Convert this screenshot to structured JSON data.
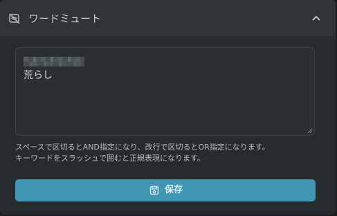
{
  "header": {
    "title": "ワードミュート",
    "icon": "mute-eye-off-icon",
    "toggle_icon": "chevron-up-icon"
  },
  "textarea": {
    "line2": "荒らし",
    "has_redacted_first_line": true
  },
  "help": {
    "line1": "スペースで区切るとAND指定になり、改行で区切るとOR指定になります。",
    "line2": "キーワードをスラッシュで囲むと正規表現になります。"
  },
  "save_button": {
    "label": "保存",
    "icon": "save-icon"
  },
  "colors": {
    "background": "#262b2d",
    "header": "#2f3537",
    "accent": "#4196b3"
  }
}
